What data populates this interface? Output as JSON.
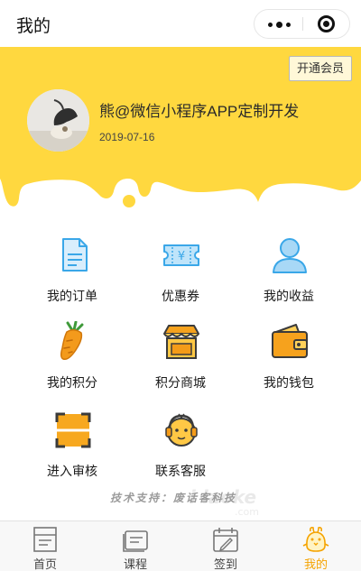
{
  "nav": {
    "title": "我的"
  },
  "banner": {
    "vip_button": "开通会员",
    "accent": "#FFD83F"
  },
  "user": {
    "name": "熊@微信小程序APP定制开发",
    "date": "2019-07-16"
  },
  "menu": [
    {
      "label": "我的订单",
      "icon": "document-icon"
    },
    {
      "label": "优惠券",
      "icon": "coupon-icon"
    },
    {
      "label": "我的收益",
      "icon": "user-icon"
    },
    {
      "label": "我的积分",
      "icon": "carrot-icon"
    },
    {
      "label": "积分商城",
      "icon": "shop-icon"
    },
    {
      "label": "我的钱包",
      "icon": "wallet-icon"
    },
    {
      "label": "进入审核",
      "icon": "scan-icon"
    },
    {
      "label": "联系客服",
      "icon": "headset-icon"
    }
  ],
  "footer": {
    "support": "技术支持：废话客科技",
    "watermark": "i laoke.com"
  },
  "tabs": [
    {
      "label": "首页",
      "icon": "home-icon"
    },
    {
      "label": "课程",
      "icon": "course-icon"
    },
    {
      "label": "签到",
      "icon": "checkin-icon"
    },
    {
      "label": "我的",
      "icon": "chick-icon",
      "active": true
    }
  ]
}
